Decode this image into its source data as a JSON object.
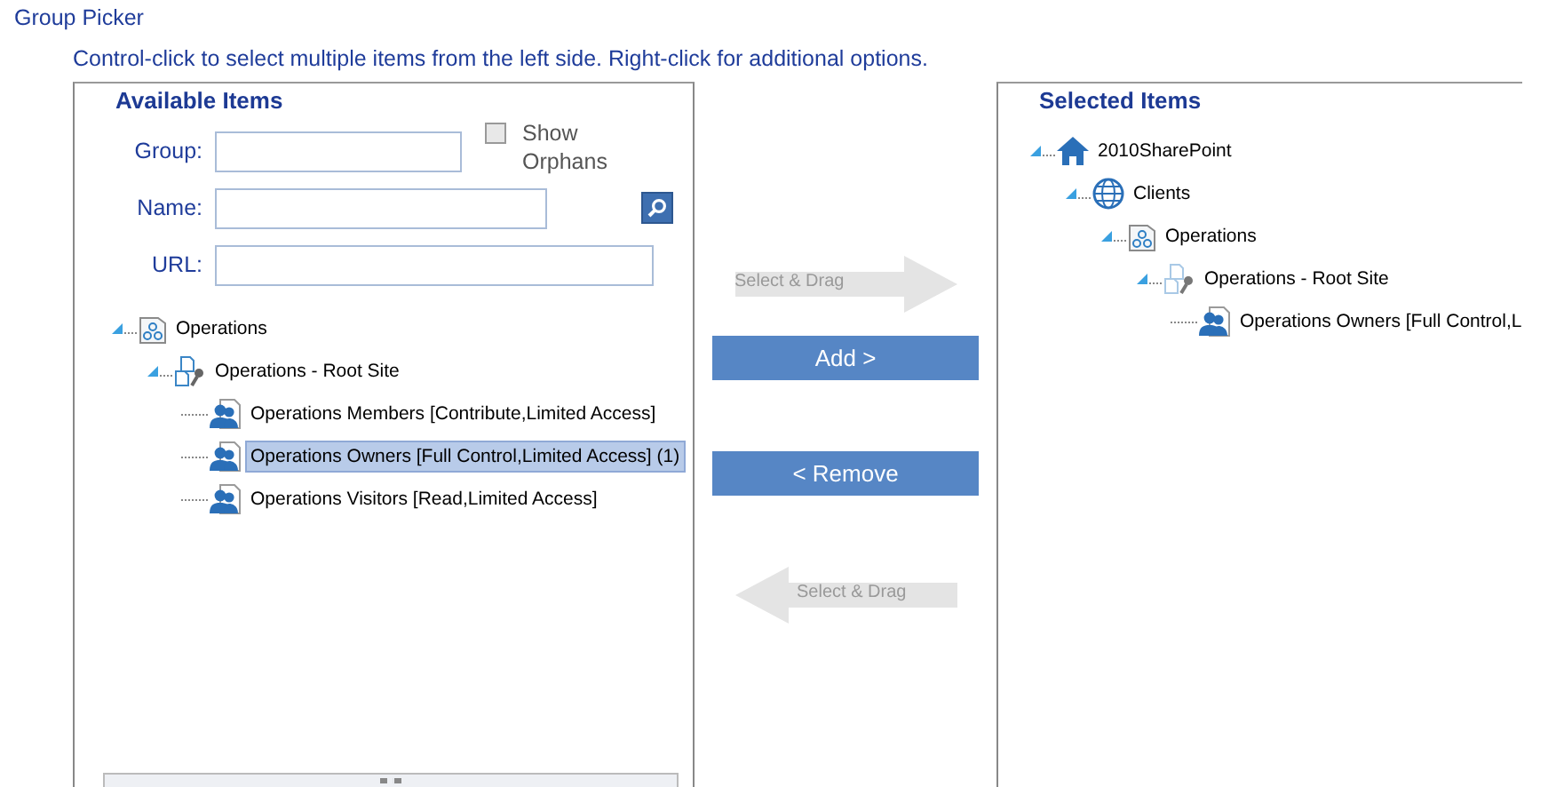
{
  "title": "Group Picker",
  "instructions": "Control-click to select multiple items from the left side. Right-click for additional options.",
  "available": {
    "heading": "Available Items",
    "fields": [
      {
        "label": "Group:",
        "kind": "short"
      },
      {
        "label": "Name:",
        "kind": "medium"
      },
      {
        "label": "URL:",
        "kind": "long"
      }
    ],
    "show_orphans": {
      "label": "Show Orphans",
      "checked": false
    },
    "tree": [
      {
        "label": "Operations",
        "kind": "collection",
        "expanded": true,
        "selected": false,
        "children": [
          {
            "label": "Operations - Root Site",
            "kind": "site",
            "expanded": true,
            "selected": false,
            "children": [
              {
                "label": "Operations Members [Contribute,Limited Access]",
                "kind": "group",
                "selected": false
              },
              {
                "label": "Operations Owners [Full Control,Limited Access] (1)",
                "kind": "group",
                "selected": true
              },
              {
                "label": "Operations Visitors [Read,Limited Access]",
                "kind": "group",
                "selected": false
              }
            ]
          }
        ]
      }
    ]
  },
  "drag_hint_right": "Select & Drag",
  "add_button": "Add >",
  "remove_button": "< Remove",
  "drag_hint_left": "Select & Drag",
  "selected": {
    "heading": "Selected Items",
    "tree": [
      {
        "label": "2010SharePoint",
        "kind": "farm",
        "expanded": true,
        "selected": false,
        "children": [
          {
            "label": "Clients",
            "kind": "web",
            "expanded": true,
            "selected": false,
            "children": [
              {
                "label": "Operations",
                "kind": "collection",
                "expanded": true,
                "selected": false,
                "children": [
                  {
                    "label": "Operations - Root Site",
                    "kind": "site",
                    "expanded": true,
                    "selected": false,
                    "children": [
                      {
                        "label": "Operations Owners [Full Control,L",
                        "kind": "group",
                        "selected": false
                      }
                    ]
                  }
                ]
              }
            ]
          }
        ]
      }
    ]
  }
}
